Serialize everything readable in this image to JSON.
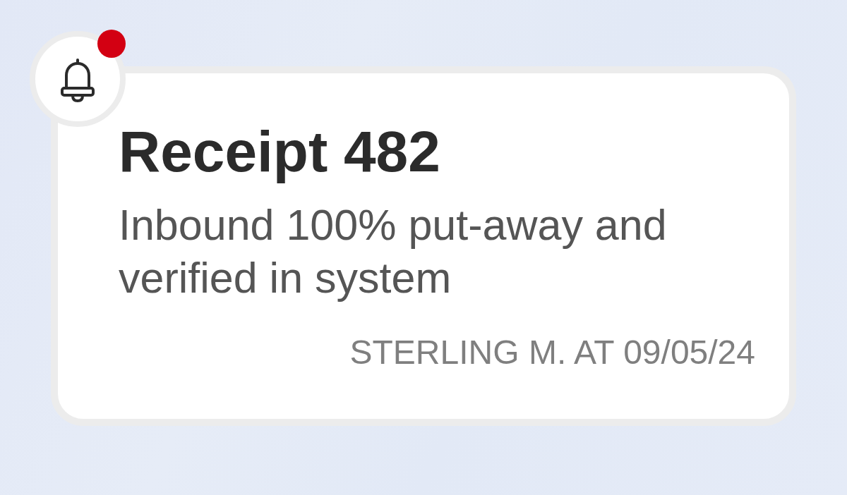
{
  "notification": {
    "unread": true,
    "title": "Receipt 482",
    "message": "Inbound 100% put-away and verified in system",
    "footer": "STERLING M. AT 09/05/24"
  }
}
